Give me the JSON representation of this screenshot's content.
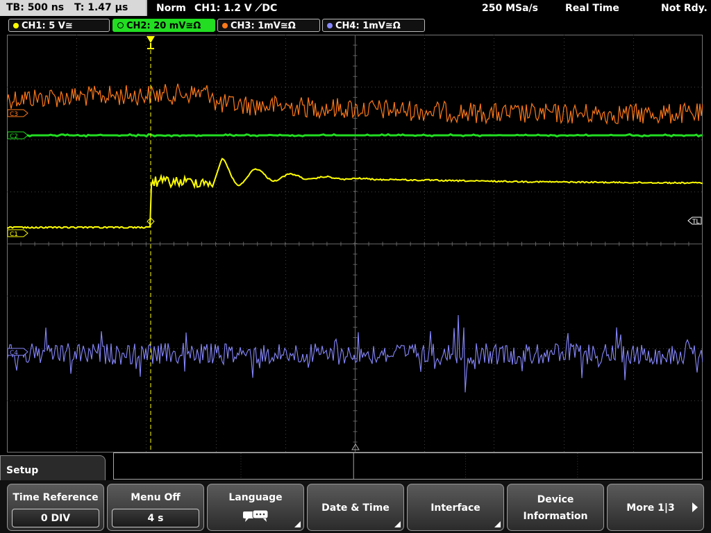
{
  "topbar": {
    "timebase": "TB: 500 ns",
    "trigger_time": "T: 1.47 µs",
    "mode": "Norm",
    "trigger_source": "CH1: 1.2 V ⟋DC",
    "sample_rate": "250 MSa/s",
    "acq_mode": "Real Time",
    "status": "Not Rdy."
  },
  "channels": [
    {
      "label": "CH1: 5 V≅",
      "color": "#ffff00",
      "active": false
    },
    {
      "label": "CH2: 20 mV≅Ω",
      "color": "#22dd22",
      "active": true
    },
    {
      "label": "CH3: 1mV≅Ω",
      "color": "#ff7a1a",
      "active": false
    },
    {
      "label": "CH4: 1mV≅Ω",
      "color": "#8888ff",
      "active": false
    }
  ],
  "markers": {
    "c3": "C3",
    "c1": "C1",
    "c2": "C2",
    "c4": "C4",
    "tl": "TL"
  },
  "menu": {
    "title": "Setup",
    "time_reference": {
      "label": "Time Reference",
      "value": "0 DIV"
    },
    "menu_off": {
      "label": "Menu Off",
      "value": "4 s"
    },
    "language": {
      "label": "Language"
    },
    "date_time": {
      "label": "Date & Time"
    },
    "interface": {
      "label": "Interface"
    },
    "device_info": {
      "label1": "Device",
      "label2": "Information"
    },
    "more": {
      "label": "More 1|3"
    }
  },
  "colors": {
    "ch1": "#ffff00",
    "ch2": "#22dd22",
    "ch3": "#ff7a1a",
    "ch4": "#8888ff",
    "grid": "#555555"
  }
}
